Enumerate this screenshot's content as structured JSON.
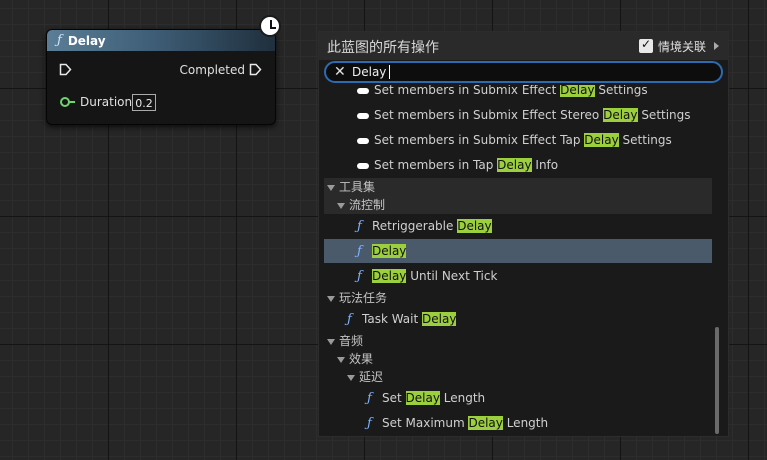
{
  "node": {
    "title": "Delay",
    "icon": "function-icon",
    "pins": {
      "exec_in": "exec-pin",
      "completed_label": "Completed",
      "duration_label": "Duration",
      "duration_value": "0.2"
    }
  },
  "menu": {
    "title": "此蓝图的所有操作",
    "context_sensitive_label": "情境关联",
    "context_sensitive_checked": true,
    "search": {
      "value": "Delay",
      "highlight": "Delay"
    },
    "rows": [
      {
        "kind": "item",
        "icon": "struct-icon",
        "pre": "Set members in Submix Effect ",
        "hl": "Delay",
        "post": " Settings",
        "indent": 2
      },
      {
        "kind": "item",
        "icon": "struct-icon",
        "pre": "Set members in Submix Effect Stereo ",
        "hl": "Delay",
        "post": " Settings",
        "indent": 2
      },
      {
        "kind": "item",
        "icon": "struct-icon",
        "pre": "Set members in Submix Effect Tap ",
        "hl": "Delay",
        "post": " Settings",
        "indent": 2
      },
      {
        "kind": "item",
        "icon": "struct-icon",
        "pre": "Set members in Tap ",
        "hl": "Delay",
        "post": " Info",
        "indent": 2
      },
      {
        "kind": "cat",
        "label": "工具集",
        "indent": 0,
        "dark": true
      },
      {
        "kind": "cat",
        "label": "流控制",
        "indent": 1,
        "dark": true
      },
      {
        "kind": "item",
        "icon": "function-icon",
        "pre": "Retriggerable ",
        "hl": "Delay",
        "post": "",
        "indent": 2
      },
      {
        "kind": "item",
        "icon": "function-icon",
        "pre": "",
        "hl": "Delay",
        "post": "",
        "indent": 2,
        "selected": true
      },
      {
        "kind": "item",
        "icon": "function-icon",
        "pre": "",
        "hl": "Delay",
        "post": " Until Next Tick",
        "indent": 2
      },
      {
        "kind": "cat",
        "label": "玩法任务",
        "indent": 0
      },
      {
        "kind": "item",
        "icon": "function-icon",
        "pre": "Task Wait ",
        "hl": "Delay",
        "post": "",
        "indent": 1
      },
      {
        "kind": "cat",
        "label": "音频",
        "indent": 0
      },
      {
        "kind": "cat",
        "label": "效果",
        "indent": 1
      },
      {
        "kind": "cat",
        "label": "延迟",
        "indent": 2
      },
      {
        "kind": "item",
        "icon": "function-icon",
        "pre": "Set ",
        "hl": "Delay",
        "post": " Length",
        "indent": 3
      },
      {
        "kind": "item",
        "icon": "function-icon",
        "pre": "Set Maximum ",
        "hl": "Delay",
        "post": " Length",
        "indent": 3
      }
    ]
  },
  "colors": {
    "highlight": "#9ccf3e",
    "selected_row": "#4a5a6b",
    "search_border": "#2d6bb0",
    "function_icon": "#7fb2ff",
    "duration_pin": "#6fd36f"
  }
}
